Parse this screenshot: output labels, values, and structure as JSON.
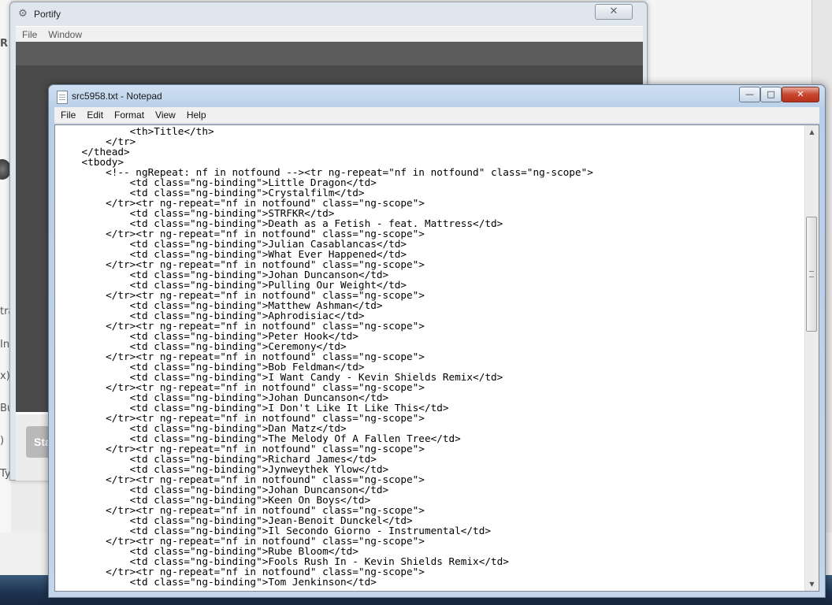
{
  "portify": {
    "title": "Portify",
    "menu": [
      "File",
      "Window"
    ],
    "start_button_label": "Sta"
  },
  "background": {
    "left_fragments": [
      "R",
      "tra",
      "In",
      "x)",
      "Bu",
      ")",
      "Ty"
    ]
  },
  "notepad": {
    "title": "src5958.txt - Notepad",
    "menu": [
      "File",
      "Edit",
      "Format",
      "View",
      "Help"
    ],
    "lines": [
      "            <th>Title</th>",
      "        </tr>",
      "    </thead>",
      "    <tbody>",
      "        <!-- ngRepeat: nf in notfound --><tr ng-repeat=\"nf in notfound\" class=\"ng-scope\">",
      "            <td class=\"ng-binding\">Little Dragon</td>",
      "            <td class=\"ng-binding\">Crystalfilm</td>",
      "        </tr><tr ng-repeat=\"nf in notfound\" class=\"ng-scope\">",
      "            <td class=\"ng-binding\">STRFKR</td>",
      "            <td class=\"ng-binding\">Death as a Fetish - feat. Mattress</td>",
      "        </tr><tr ng-repeat=\"nf in notfound\" class=\"ng-scope\">",
      "            <td class=\"ng-binding\">Julian Casablancas</td>",
      "            <td class=\"ng-binding\">What Ever Happened</td>",
      "        </tr><tr ng-repeat=\"nf in notfound\" class=\"ng-scope\">",
      "            <td class=\"ng-binding\">Johan Duncanson</td>",
      "            <td class=\"ng-binding\">Pulling Our Weight</td>",
      "        </tr><tr ng-repeat=\"nf in notfound\" class=\"ng-scope\">",
      "            <td class=\"ng-binding\">Matthew Ashman</td>",
      "            <td class=\"ng-binding\">Aphrodisiac</td>",
      "        </tr><tr ng-repeat=\"nf in notfound\" class=\"ng-scope\">",
      "            <td class=\"ng-binding\">Peter Hook</td>",
      "            <td class=\"ng-binding\">Ceremony</td>",
      "        </tr><tr ng-repeat=\"nf in notfound\" class=\"ng-scope\">",
      "            <td class=\"ng-binding\">Bob Feldman</td>",
      "            <td class=\"ng-binding\">I Want Candy - Kevin Shields Remix</td>",
      "        </tr><tr ng-repeat=\"nf in notfound\" class=\"ng-scope\">",
      "            <td class=\"ng-binding\">Johan Duncanson</td>",
      "            <td class=\"ng-binding\">I Don't Like It Like This</td>",
      "        </tr><tr ng-repeat=\"nf in notfound\" class=\"ng-scope\">",
      "            <td class=\"ng-binding\">Dan Matz</td>",
      "            <td class=\"ng-binding\">The Melody Of A Fallen Tree</td>",
      "        </tr><tr ng-repeat=\"nf in notfound\" class=\"ng-scope\">",
      "            <td class=\"ng-binding\">Richard James</td>",
      "            <td class=\"ng-binding\">Jynweythek Ylow</td>",
      "        </tr><tr ng-repeat=\"nf in notfound\" class=\"ng-scope\">",
      "            <td class=\"ng-binding\">Johan Duncanson</td>",
      "            <td class=\"ng-binding\">Keen On Boys</td>",
      "        </tr><tr ng-repeat=\"nf in notfound\" class=\"ng-scope\">",
      "            <td class=\"ng-binding\">Jean-Benoit Dunckel</td>",
      "            <td class=\"ng-binding\">Il Secondo Giorno - Instrumental</td>",
      "        </tr><tr ng-repeat=\"nf in notfound\" class=\"ng-scope\">",
      "            <td class=\"ng-binding\">Rube Bloom</td>",
      "            <td class=\"ng-binding\">Fools Rush In - Kevin Shields Remix</td>",
      "        </tr><tr ng-repeat=\"nf in notfound\" class=\"ng-scope\">",
      "            <td class=\"ng-binding\">Tom Jenkinson</td>"
    ],
    "scrollbar": {
      "position_fraction": 0.24
    }
  }
}
